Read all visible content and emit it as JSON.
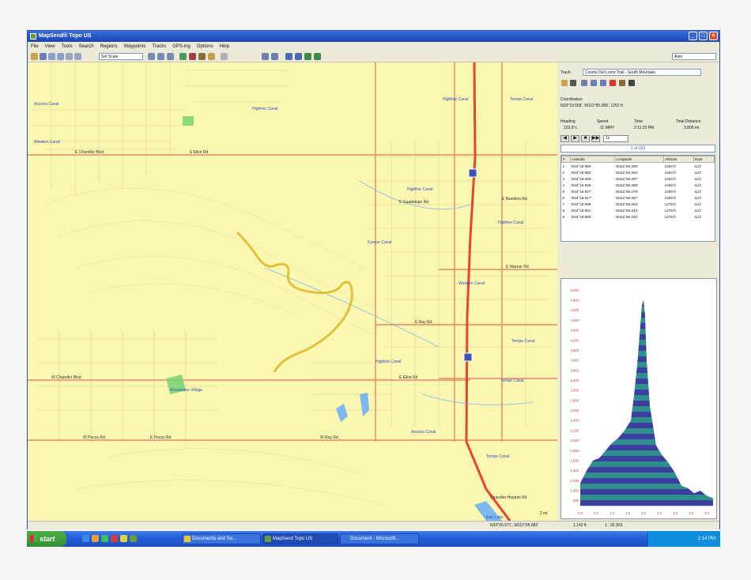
{
  "window": {
    "title": "MapSend® Topo US",
    "menu": [
      "File",
      "View",
      "Tools",
      "Search",
      "Regions",
      "Waypoints",
      "Tracks",
      "GPS-ing",
      "Options",
      "Help"
    ]
  },
  "toolbar": {
    "scale_value": "Set Scale",
    "zoom_value": "Auto"
  },
  "map": {
    "place_labels": [
      "Highline Canal",
      "Highline Canal",
      "Highline Canal",
      "Highline Canal",
      "Highline Canal",
      "Western Canal",
      "Western Canal",
      "Kyrene Canal",
      "Tempe Canal",
      "Ahwatukee Village",
      "Arizona Canal",
      "Tempe Canal",
      "Tempe Canal",
      "Tempe Canal",
      "Kerr Lake",
      "Arizona Canal"
    ],
    "road_labels": [
      "E Chandler Blvd",
      "E Elliot Rd",
      "W Chandler Blvd",
      "E Guadalupe Rd",
      "E Warner Rd",
      "E Ray Rd",
      "W Pecos Rd",
      "E Pecos Rd",
      "E Baseline Rd",
      "E Elliot Rd",
      "W Ray Rd"
    ],
    "scale_text": "2 mi",
    "overlay_text": "Chandler Heights Rd"
  },
  "panel": {
    "track_label": "Track:",
    "track_value": "Cosmo Del Lomo Trail - South Mountain",
    "coordinate_label": "Coordinates:",
    "coordinate_value": "N33°19.558', W111°55.289', 1252 ft",
    "headers": [
      "Heading",
      "Speed",
      "Time",
      "Total Distance"
    ],
    "values": [
      "103.6°c",
      "11 MPH",
      "2:11:23 PM",
      "3.800 mi"
    ],
    "speed_select": "1x",
    "progress_text": "1 of 153",
    "table_headers": [
      "#",
      "Latitude",
      "Longitude",
      "Altitude",
      "Date"
    ],
    "table_rows": [
      [
        "1",
        "N33°18.950'",
        "W111°59.308'",
        "1252 ft",
        "11/2"
      ],
      [
        "2",
        "N33°18.952'",
        "W111°59.302'",
        "1252 ft",
        "11/2"
      ],
      [
        "3",
        "N33°18.948'",
        "W111°59.297'",
        "1252 ft",
        "11/2"
      ],
      [
        "4",
        "N33°18.935'",
        "W111°59.288'",
        "1256 ft",
        "11/2"
      ],
      [
        "5",
        "N33°18.927'",
        "W111°59.276'",
        "1256 ft",
        "11/2"
      ],
      [
        "6",
        "N33°18.917'",
        "W111°59.267'",
        "1256 ft",
        "11/2"
      ],
      [
        "7",
        "N33°18.908'",
        "W111°59.254'",
        "1275 ft",
        "11/2"
      ],
      [
        "8",
        "N33°18.901'",
        "W111°59.243'",
        "1275 ft",
        "11/2"
      ],
      [
        "9",
        "N33°18.893'",
        "W111°59.232'",
        "1275 ft",
        "11/2"
      ]
    ]
  },
  "statusbar": {
    "coords": "N33°26.571', W112°05.682'",
    "elev": "1,142 ft",
    "scale": "1 : 92,303"
  },
  "taskbar": {
    "start": "start",
    "tasks": [
      "Documents and Se...",
      "MapSend Topo US",
      "Document - Microsoft..."
    ],
    "clock": "2:14 PM"
  },
  "colors": {
    "map_background": "#fbf6b0",
    "road": "#e8886b",
    "highway": "#e8442e",
    "track": "#e0c23a",
    "water": "#7db8f0",
    "chart_fill_a": "#3a3fa0",
    "chart_fill_b": "#2f8f8f"
  },
  "chart_data": {
    "type": "area",
    "title": "",
    "xlabel": "",
    "ylabel": "",
    "y_tick_labels": [
      "5,000",
      "4,800",
      "4,600",
      "4,400",
      "4,200",
      "4,000",
      "3,800",
      "3,600",
      "3,400",
      "3,200",
      "3,000",
      "2,800",
      "2,600",
      "2,400",
      "2,200",
      "2,000",
      "1,800",
      "1,600",
      "1,400",
      "1,200",
      "1,000",
      "800"
    ],
    "x_tick_labels": [
      "0.0",
      "0.5",
      "1.0",
      "1.5",
      "2.0",
      "2.5",
      "3.0",
      "3.5",
      "4.0"
    ],
    "ylim": [
      700,
      5100
    ],
    "xlim": [
      0,
      4.2
    ],
    "x": [
      0.0,
      0.2,
      0.4,
      0.6,
      0.8,
      1.0,
      1.2,
      1.4,
      1.6,
      1.7,
      1.8,
      1.9,
      1.95,
      2.0,
      2.05,
      2.1,
      2.2,
      2.3,
      2.4,
      2.6,
      2.8,
      3.0,
      3.2,
      3.4,
      3.6,
      3.8,
      4.0,
      4.2
    ],
    "values": [
      1150,
      1400,
      1600,
      1650,
      1800,
      1950,
      2050,
      2200,
      2400,
      2900,
      3500,
      4300,
      4700,
      4800,
      4500,
      3600,
      2700,
      2300,
      1900,
      1700,
      1550,
      1350,
      1100,
      1050,
      950,
      1000,
      900,
      850
    ],
    "grid": false
  }
}
